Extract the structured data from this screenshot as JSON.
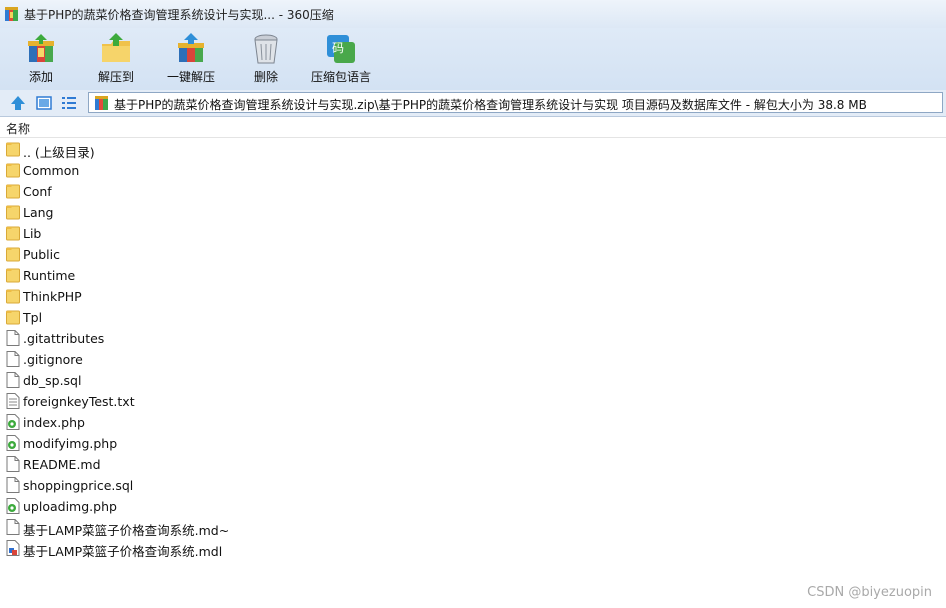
{
  "window": {
    "title": "基于PHP的蔬菜价格查询管理系统设计与实现... - 360压缩"
  },
  "toolbar": [
    {
      "label": "添加",
      "icon": "add-archive-icon"
    },
    {
      "label": "解压到",
      "icon": "extract-to-icon"
    },
    {
      "label": "一键解压",
      "icon": "one-click-extract-icon"
    },
    {
      "label": "删除",
      "icon": "delete-trash-icon"
    },
    {
      "label": "压缩包语言",
      "icon": "archive-language-icon"
    }
  ],
  "nav": {
    "path": "基于PHP的蔬菜价格查询管理系统设计与实现.zip\\基于PHP的蔬菜价格查询管理系统设计与实现 项目源码及数据库文件 - 解包大小为 38.8 MB"
  },
  "columns": {
    "name": "名称"
  },
  "files": [
    {
      "name": ".. (上级目录)",
      "type": "folder"
    },
    {
      "name": "Common",
      "type": "folder"
    },
    {
      "name": "Conf",
      "type": "folder"
    },
    {
      "name": "Lang",
      "type": "folder"
    },
    {
      "name": "Lib",
      "type": "folder"
    },
    {
      "name": "Public",
      "type": "folder"
    },
    {
      "name": "Runtime",
      "type": "folder"
    },
    {
      "name": "ThinkPHP",
      "type": "folder"
    },
    {
      "name": "Tpl",
      "type": "folder"
    },
    {
      "name": ".gitattributes",
      "type": "file"
    },
    {
      "name": ".gitignore",
      "type": "file"
    },
    {
      "name": "db_sp.sql",
      "type": "file"
    },
    {
      "name": "foreignkeyTest.txt",
      "type": "text"
    },
    {
      "name": "index.php",
      "type": "php"
    },
    {
      "name": "modifyimg.php",
      "type": "php"
    },
    {
      "name": "README.md",
      "type": "file"
    },
    {
      "name": "shoppingprice.sql",
      "type": "file"
    },
    {
      "name": "uploadimg.php",
      "type": "php"
    },
    {
      "name": "基于LAMP菜篮子价格查询系统.md~",
      "type": "file"
    },
    {
      "name": "基于LAMP菜篮子价格查询系统.mdl",
      "type": "mdl"
    }
  ],
  "watermark": "CSDN @biyezuopin"
}
